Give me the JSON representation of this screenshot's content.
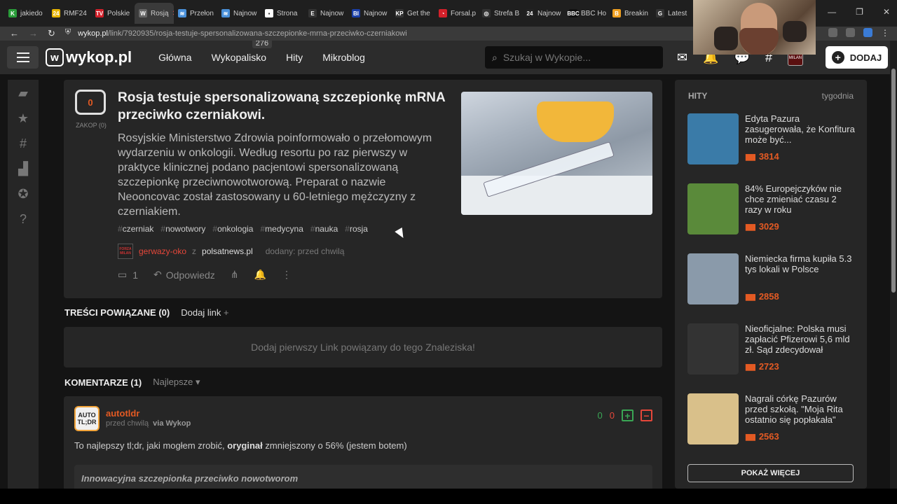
{
  "browser": {
    "tabs": [
      {
        "label": "jakiedo",
        "color": "#2a9d3a",
        "glyph": "K"
      },
      {
        "label": "RMF24",
        "color": "#e8b400",
        "glyph": "24"
      },
      {
        "label": "Polskie",
        "color": "#d3202a",
        "glyph": "TV"
      },
      {
        "label": "Rosją",
        "color": "#666666",
        "glyph": "W",
        "active": true
      },
      {
        "label": "Przełon",
        "color": "#4a90d9",
        "glyph": "≋"
      },
      {
        "label": "Najnow",
        "color": "#4a90d9",
        "glyph": "≋"
      },
      {
        "label": "Strona",
        "color": "#ffffff",
        "glyph": "▪"
      },
      {
        "label": "Najnow",
        "color": "#333333",
        "glyph": "E"
      },
      {
        "label": "Najnow",
        "color": "#1a3fa8",
        "glyph": "BI"
      },
      {
        "label": "Get the",
        "color": "#333333",
        "glyph": "KP"
      },
      {
        "label": "Forsal.p",
        "color": "#d3202a",
        "glyph": "◔"
      },
      {
        "label": "Strefa B",
        "color": "#333333",
        "glyph": "◎"
      },
      {
        "label": "Najnow",
        "color": "#222222",
        "glyph": "24"
      },
      {
        "label": "BBC Ho",
        "color": "#111111",
        "glyph": "BBC"
      },
      {
        "label": "Breakin",
        "color": "#f0a020",
        "glyph": "B"
      },
      {
        "label": "Latest",
        "color": "#333333",
        "glyph": "G"
      }
    ],
    "url_domain": "wykop.pl",
    "url_path": "/link/7920935/rosja-testuje-spersonalizowana-szczepionke-mrna-przeciwko-czerniakowi"
  },
  "header": {
    "logo": "wykop.pl",
    "nav": [
      {
        "label": "Główna"
      },
      {
        "label": "Wykopalisko",
        "badge": "276"
      },
      {
        "label": "Hity"
      },
      {
        "label": "Mikroblog"
      }
    ],
    "search_placeholder": "Szukaj w Wykopie...",
    "add_label": "DODAJ"
  },
  "article": {
    "votes": "0",
    "bury_label": "ZAKOP (0)",
    "title": "Rosja testuje spersonalizowaną szczepionkę mRNA przeciwko czerniakowi.",
    "description": "Rosyjskie Ministerstwo Zdrowia poinformowało o przełomowym wydarzeniu w onkologii. Według resortu po raz pierwszy w praktyce klinicznej podano pacjentowi spersonalizowaną szczepionkę przeciwnowotworową. Preparat o nazwie Neooncovac został zastosowany u 60-letniego mężczyzny z czerniakiem.",
    "tags": [
      "czerniak",
      "nowotwory",
      "onkologia",
      "medycyna",
      "nauka",
      "rosja"
    ],
    "author_avatar_text": "FORZA MILAN",
    "author": "gerwazy-oko",
    "source_prefix": "z",
    "source": "polsatnews.pl",
    "added": "dodany: przed chwilą",
    "comments_count": "1",
    "reply_label": "Odpowiedz"
  },
  "related": {
    "title": "TREŚCI POWIĄZANE (0)",
    "add_link": "Dodaj link",
    "empty_text": "Dodaj pierwszy Link powiązany do tego Znaleziska!"
  },
  "comments": {
    "title": "KOMENTARZE (1)",
    "sort": "Najlepsze",
    "items": [
      {
        "avatar_text": "AUTO TL;DR",
        "author": "autotldr",
        "time": "przed chwilą",
        "via": "via Wykop",
        "up": "0",
        "down": "0",
        "text_before": "To najlepszy tl;dr, jaki mogłem zrobić, ",
        "text_bold": "oryginał",
        "text_after": " zmniejszony o 56% (jestem botem)",
        "quote": "Innowacyjna szczepionka przeciwko nowotworom"
      }
    ]
  },
  "sidebar": {
    "title": "HITY",
    "period": "tygodnia",
    "items": [
      {
        "title": "Edyta Pazura zasugerowała, że Konfitura może być...",
        "score": "3814",
        "img_color": "#3a7ba8"
      },
      {
        "title": "84% Europejczyków nie chce zmieniać czasu 2 razy w roku",
        "score": "3029",
        "img_color": "#5a8a3a"
      },
      {
        "title": "Niemiecka firma kupiła 5.3 tys lokali w Polsce",
        "score": "2858",
        "img_color": "#8a9aaa"
      },
      {
        "title": "Nieoficjalne: Polska musi zapłacić Pfizerowi 5,6 mld zł. Sąd zdecydował",
        "score": "2723",
        "img_color": "#333333"
      },
      {
        "title": "Nagrali córkę Pazurów przed szkołą. \"Moja Rita ostatnio się popłakała\"",
        "score": "2563",
        "img_color": "#d9c08a"
      }
    ],
    "more_label": "POKAŻ WIĘCEJ"
  }
}
